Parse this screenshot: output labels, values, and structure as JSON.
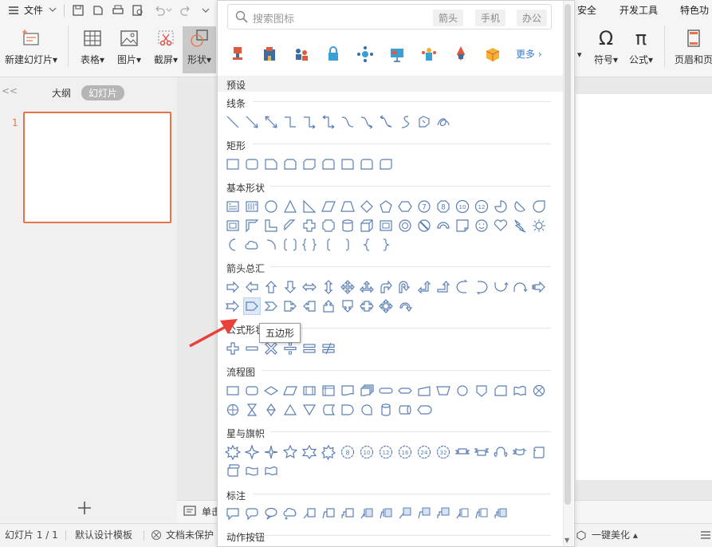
{
  "menubar": {
    "file_label": "文件",
    "right_tabs": [
      "安全",
      "开发工具",
      "特色功"
    ]
  },
  "ribbon": {
    "new_slide": "新建幻灯片",
    "table": "表格",
    "picture": "图片",
    "screenshot": "截屏",
    "shape": "形状",
    "symbol": "符号",
    "formula": "公式",
    "header_footer": "页眉和页"
  },
  "left_panel": {
    "tab_outline": "大纲",
    "tab_slides": "幻灯片",
    "slide_number": "1",
    "collapse_glyph": "<<"
  },
  "notes": {
    "placeholder": "单击"
  },
  "status": {
    "slide_count": "幻灯片 1 / 1",
    "template": "默认设计模板",
    "protect": "文档未保护",
    "beautify": "一键美化"
  },
  "dropdown": {
    "search_placeholder": "搜索图标",
    "chips": [
      "箭头",
      "手机",
      "办公"
    ],
    "more_label": "更多",
    "preset_label": "预设",
    "sections": {
      "lines": "线条",
      "rect": "矩形",
      "basic": "基本形状",
      "arrows": "箭头总汇",
      "equation": "公式形状",
      "flowchart": "流程图",
      "stars": "星与旗帜",
      "callouts": "标注",
      "action": "动作按钮"
    },
    "tooltip": "五边形",
    "highlighted_shape": "pentagon-arrow"
  },
  "colors": {
    "accent_orange": "#e8734a",
    "shape_stroke": "#5b7fb5",
    "annotation_arrow": "#e8413a"
  }
}
